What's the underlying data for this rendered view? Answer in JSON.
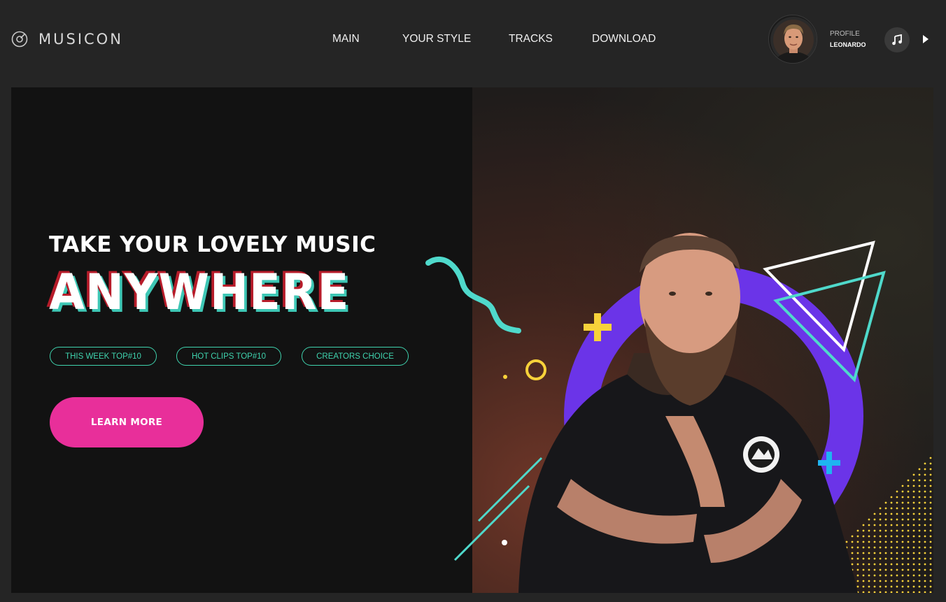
{
  "brand": {
    "name": "MUSICON",
    "icon": "vinyl-disc-icon"
  },
  "nav": {
    "items": [
      {
        "label": "MAIN"
      },
      {
        "label": "YOUR STYLE"
      },
      {
        "label": "TRACKS"
      },
      {
        "label": "DOWNLOAD"
      }
    ]
  },
  "profile": {
    "label": "PROFILE",
    "name": "LEONARDO",
    "avatar_icon": "user-avatar",
    "music_icon": "music-note-icon",
    "play_icon": "play-icon"
  },
  "hero": {
    "tagline": "TAKE YOUR LOVELY MUSIC",
    "headline": "ANYWHERE",
    "tags": [
      "THIS WEEK TOP#10",
      "HOT CLIPS TOP#10",
      "CREATORS CHOICE"
    ],
    "cta_label": "LEARN MORE"
  },
  "colors": {
    "accent_pink": "#e82f9a",
    "accent_teal": "#3fd3ae",
    "accent_purple": "#6b34e8",
    "accent_yellow": "#f7d23a",
    "accent_blue": "#1fb4f0",
    "headline_shadow_red": "#b71c2a"
  }
}
